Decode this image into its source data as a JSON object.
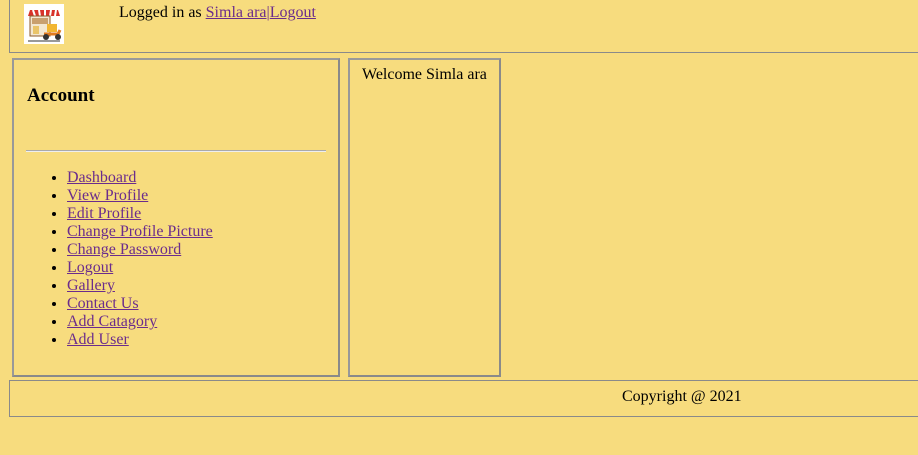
{
  "header": {
    "logged_in_prefix": "Logged in as",
    "user_name": "Simla ara",
    "separator": "|",
    "logout_label": "Logout"
  },
  "sidebar": {
    "heading": "Account",
    "items": [
      {
        "label": "Dashboard"
      },
      {
        "label": "View Profile"
      },
      {
        "label": "Edit Profile"
      },
      {
        "label": "Change Profile Picture"
      },
      {
        "label": "Change Password"
      },
      {
        "label": "Logout"
      },
      {
        "label": "Gallery"
      },
      {
        "label": "Contact Us"
      },
      {
        "label": "Add Catagory"
      },
      {
        "label": "Add User"
      }
    ]
  },
  "main": {
    "welcome_text": "Welcome Simla ara"
  },
  "footer": {
    "copyright": "Copyright @ 2021"
  },
  "colors": {
    "page_background": "#f7dc7e",
    "link": "#6b2c8c",
    "border": "#8a8a8a"
  },
  "icons": {
    "logo": "shop-delivery-logo-icon"
  }
}
